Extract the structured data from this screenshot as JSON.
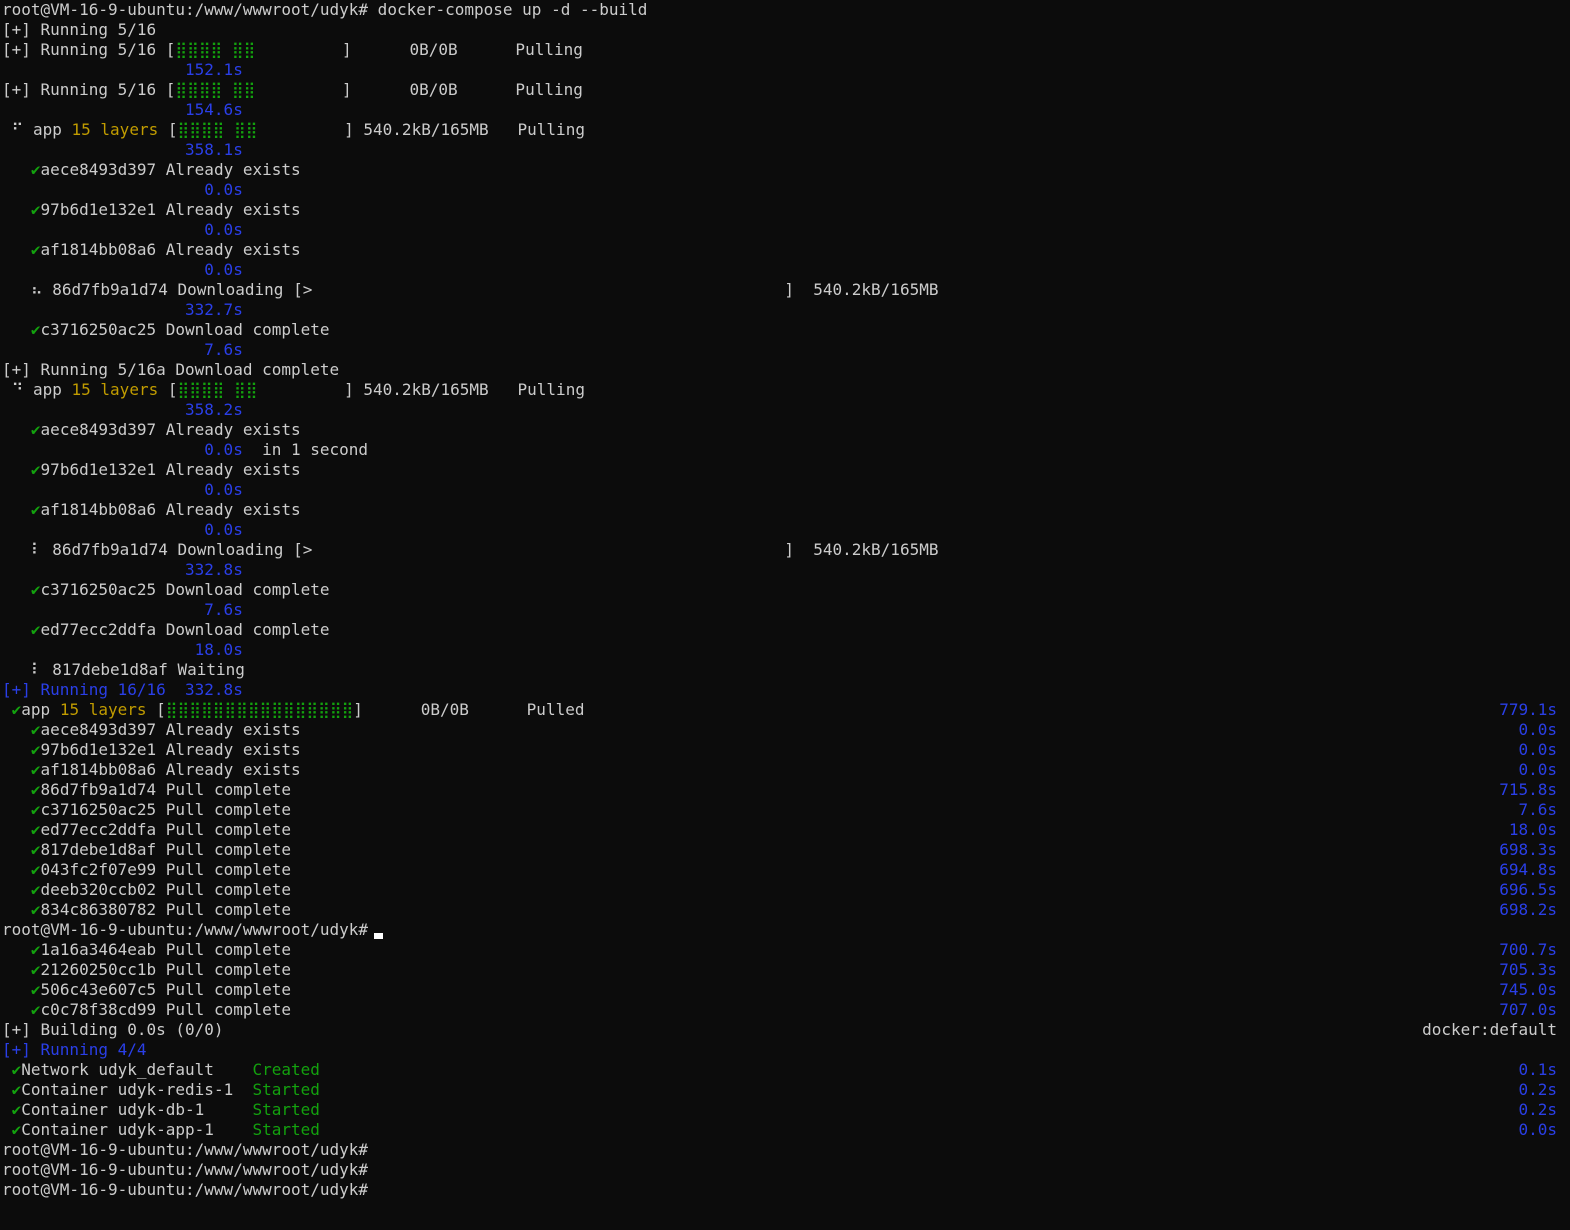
{
  "window": {
    "title": "root@VM-16-9-ubuntu: /www/wwwroot/udyk",
    "cursor_line": 46
  },
  "colors": {
    "background": "#0c0c0c",
    "text": "#cccccc",
    "blue": "#2a3fe8",
    "yellow": "#c19c00",
    "green": "#13a10e"
  },
  "terminal": {
    "lines": [
      {
        "segs": [
          {
            "t": "root@VM-16-9-ubuntu:/www/wwwroot/udyk# docker-compose up -d --build",
            "c": "default"
          }
        ]
      },
      {
        "segs": [
          {
            "t": "[+] Running 5/16",
            "c": "default"
          }
        ]
      },
      {
        "segs": [
          {
            "t": "[+] Running 5/16 [",
            "c": "default"
          },
          {
            "t": "⣿⣿⣿⣿ ⣿⣿",
            "c": "green"
          },
          {
            "t": "         ]      0B/0B      Pulling",
            "c": "default"
          }
        ]
      },
      {
        "segs": [
          {
            "t": "                   152.1s",
            "c": "blue"
          }
        ]
      },
      {
        "segs": [
          {
            "t": "[+] Running 5/16 [",
            "c": "default"
          },
          {
            "t": "⣿⣿⣿⣿ ⣿⣿",
            "c": "green"
          },
          {
            "t": "         ]      0B/0B      Pulling",
            "c": "default"
          }
        ]
      },
      {
        "segs": [
          {
            "t": "                   154.6s",
            "c": "blue"
          }
        ]
      },
      {
        "segs": [
          {
            "t": " ⠋ app ",
            "c": "default"
          },
          {
            "t": "15 layers",
            "c": "yellow"
          },
          {
            "t": " [",
            "c": "default"
          },
          {
            "t": "⣿⣿⣿⣿ ⣿⣿",
            "c": "green"
          },
          {
            "t": "         ] 540.2kB/165MB   Pulling",
            "c": "default"
          }
        ]
      },
      {
        "segs": [
          {
            "t": "                   358.1s",
            "c": "blue"
          }
        ]
      },
      {
        "segs": [
          {
            "t": "   ",
            "c": "default"
          },
          {
            "t": "✔",
            "c": "green"
          },
          {
            "t": "aece8493d397 Already exists",
            "c": "default"
          }
        ]
      },
      {
        "segs": [
          {
            "t": "                     0.0s",
            "c": "blue"
          }
        ]
      },
      {
        "segs": [
          {
            "t": "   ",
            "c": "default"
          },
          {
            "t": "✔",
            "c": "green"
          },
          {
            "t": "97b6d1e132e1 Already exists",
            "c": "default"
          }
        ]
      },
      {
        "segs": [
          {
            "t": "                     0.0s",
            "c": "blue"
          }
        ]
      },
      {
        "segs": [
          {
            "t": "   ",
            "c": "default"
          },
          {
            "t": "✔",
            "c": "green"
          },
          {
            "t": "af1814bb08a6 Already exists",
            "c": "default"
          }
        ]
      },
      {
        "segs": [
          {
            "t": "                     0.0s",
            "c": "blue"
          }
        ]
      },
      {
        "segs": [
          {
            "t": "   ⠦ 86d7fb9a1d74 Downloading [>                                                 ]  540.2kB/165MB",
            "c": "default"
          }
        ]
      },
      {
        "segs": [
          {
            "t": "                   332.7s",
            "c": "blue"
          }
        ]
      },
      {
        "segs": [
          {
            "t": "   ",
            "c": "default"
          },
          {
            "t": "✔",
            "c": "green"
          },
          {
            "t": "c3716250ac25 Download complete",
            "c": "default"
          }
        ]
      },
      {
        "segs": [
          {
            "t": "                     7.6s",
            "c": "blue"
          }
        ]
      },
      {
        "segs": [
          {
            "t": "[+] Running 5/16a Download complete",
            "c": "default"
          }
        ]
      },
      {
        "segs": [
          {
            "t": " ⠙ app ",
            "c": "default"
          },
          {
            "t": "15 layers",
            "c": "yellow"
          },
          {
            "t": " [",
            "c": "default"
          },
          {
            "t": "⣿⣿⣿⣿ ⣿⣿",
            "c": "green"
          },
          {
            "t": "         ] 540.2kB/165MB   Pulling",
            "c": "default"
          }
        ]
      },
      {
        "segs": [
          {
            "t": "                   358.2s",
            "c": "blue"
          }
        ]
      },
      {
        "segs": [
          {
            "t": "   ",
            "c": "default"
          },
          {
            "t": "✔",
            "c": "green"
          },
          {
            "t": "aece8493d397 Already exists",
            "c": "default"
          }
        ]
      },
      {
        "segs": [
          {
            "t": "                     0.0s",
            "c": "blue"
          },
          {
            "t": "  in 1 second",
            "c": "default"
          }
        ]
      },
      {
        "segs": [
          {
            "t": "   ",
            "c": "default"
          },
          {
            "t": "✔",
            "c": "green"
          },
          {
            "t": "97b6d1e132e1 Already exists",
            "c": "default"
          }
        ]
      },
      {
        "segs": [
          {
            "t": "                     0.0s",
            "c": "blue"
          }
        ]
      },
      {
        "segs": [
          {
            "t": "   ",
            "c": "default"
          },
          {
            "t": "✔",
            "c": "green"
          },
          {
            "t": "af1814bb08a6 Already exists",
            "c": "default"
          }
        ]
      },
      {
        "segs": [
          {
            "t": "                     0.0s",
            "c": "blue"
          }
        ]
      },
      {
        "segs": [
          {
            "t": "   ⠇ 86d7fb9a1d74 Downloading [>                                                 ]  540.2kB/165MB",
            "c": "default"
          }
        ]
      },
      {
        "segs": [
          {
            "t": "                   332.8s",
            "c": "blue"
          }
        ]
      },
      {
        "segs": [
          {
            "t": "   ",
            "c": "default"
          },
          {
            "t": "✔",
            "c": "green"
          },
          {
            "t": "c3716250ac25 Download complete",
            "c": "default"
          }
        ]
      },
      {
        "segs": [
          {
            "t": "                     7.6s",
            "c": "blue"
          }
        ]
      },
      {
        "segs": [
          {
            "t": "   ",
            "c": "default"
          },
          {
            "t": "✔",
            "c": "green"
          },
          {
            "t": "ed77ecc2ddfa Download complete",
            "c": "default"
          }
        ]
      },
      {
        "segs": [
          {
            "t": "                    18.0s",
            "c": "blue"
          }
        ]
      },
      {
        "segs": [
          {
            "t": "   ⠇ 817debe1d8af Waiting",
            "c": "default"
          }
        ]
      },
      {
        "segs": [
          {
            "t": "[+] Running 16/16  332.8s",
            "c": "blue"
          }
        ]
      },
      {
        "segs": [
          {
            "t": " ",
            "c": "default"
          },
          {
            "t": "✔",
            "c": "green"
          },
          {
            "t": "app ",
            "c": "default"
          },
          {
            "t": "15 layers",
            "c": "yellow"
          },
          {
            "t": " [",
            "c": "default"
          },
          {
            "t": "⣿⣿⣿⣿⣿⣿⣿⣿⣿⣿⣿⣿⣿⣿⣿⣿",
            "c": "green"
          },
          {
            "t": "]      0B/0B      Pulled",
            "c": "default"
          }
        ],
        "right": {
          "t": "779.1s",
          "c": "blue"
        }
      },
      {
        "segs": [
          {
            "t": "   ",
            "c": "default"
          },
          {
            "t": "✔",
            "c": "green"
          },
          {
            "t": "aece8493d397 Already exists",
            "c": "default"
          }
        ],
        "right": {
          "t": "0.0s",
          "c": "blue"
        }
      },
      {
        "segs": [
          {
            "t": "   ",
            "c": "default"
          },
          {
            "t": "✔",
            "c": "green"
          },
          {
            "t": "97b6d1e132e1 Already exists",
            "c": "default"
          }
        ],
        "right": {
          "t": "0.0s",
          "c": "blue"
        }
      },
      {
        "segs": [
          {
            "t": "   ",
            "c": "default"
          },
          {
            "t": "✔",
            "c": "green"
          },
          {
            "t": "af1814bb08a6 Already exists",
            "c": "default"
          }
        ],
        "right": {
          "t": "0.0s",
          "c": "blue"
        }
      },
      {
        "segs": [
          {
            "t": "   ",
            "c": "default"
          },
          {
            "t": "✔",
            "c": "green"
          },
          {
            "t": "86d7fb9a1d74 Pull complete",
            "c": "default"
          }
        ],
        "right": {
          "t": "715.8s",
          "c": "blue"
        }
      },
      {
        "segs": [
          {
            "t": "   ",
            "c": "default"
          },
          {
            "t": "✔",
            "c": "green"
          },
          {
            "t": "c3716250ac25 Pull complete",
            "c": "default"
          }
        ],
        "right": {
          "t": "7.6s",
          "c": "blue"
        }
      },
      {
        "segs": [
          {
            "t": "   ",
            "c": "default"
          },
          {
            "t": "✔",
            "c": "green"
          },
          {
            "t": "ed77ecc2ddfa Pull complete",
            "c": "default"
          }
        ],
        "right": {
          "t": "18.0s",
          "c": "blue"
        }
      },
      {
        "segs": [
          {
            "t": "   ",
            "c": "default"
          },
          {
            "t": "✔",
            "c": "green"
          },
          {
            "t": "817debe1d8af Pull complete",
            "c": "default"
          }
        ],
        "right": {
          "t": "698.3s",
          "c": "blue"
        }
      },
      {
        "segs": [
          {
            "t": "   ",
            "c": "default"
          },
          {
            "t": "✔",
            "c": "green"
          },
          {
            "t": "043fc2f07e99 Pull complete",
            "c": "default"
          }
        ],
        "right": {
          "t": "694.8s",
          "c": "blue"
        }
      },
      {
        "segs": [
          {
            "t": "   ",
            "c": "default"
          },
          {
            "t": "✔",
            "c": "green"
          },
          {
            "t": "deeb320ccb02 Pull complete",
            "c": "default"
          }
        ],
        "right": {
          "t": "696.5s",
          "c": "blue"
        }
      },
      {
        "segs": [
          {
            "t": "   ",
            "c": "default"
          },
          {
            "t": "✔",
            "c": "green"
          },
          {
            "t": "834c86380782 Pull complete",
            "c": "default"
          }
        ],
        "right": {
          "t": "698.2s",
          "c": "blue"
        }
      },
      {
        "segs": [
          {
            "t": "root@VM-16-9-ubuntu:/www/wwwroot/udyk#",
            "c": "default"
          }
        ]
      },
      {
        "segs": [
          {
            "t": "   ",
            "c": "default"
          },
          {
            "t": "✔",
            "c": "green"
          },
          {
            "t": "1a16a3464eab Pull complete",
            "c": "default"
          }
        ],
        "right": {
          "t": "700.7s",
          "c": "blue"
        }
      },
      {
        "segs": [
          {
            "t": "   ",
            "c": "default"
          },
          {
            "t": "✔",
            "c": "green"
          },
          {
            "t": "21260250cc1b Pull complete",
            "c": "default"
          }
        ],
        "right": {
          "t": "705.3s",
          "c": "blue"
        }
      },
      {
        "segs": [
          {
            "t": "   ",
            "c": "default"
          },
          {
            "t": "✔",
            "c": "green"
          },
          {
            "t": "506c43e607c5 Pull complete",
            "c": "default"
          }
        ],
        "right": {
          "t": "745.0s",
          "c": "blue"
        }
      },
      {
        "segs": [
          {
            "t": "   ",
            "c": "default"
          },
          {
            "t": "✔",
            "c": "green"
          },
          {
            "t": "c0c78f38cd99 Pull complete",
            "c": "default"
          }
        ],
        "right": {
          "t": "707.0s",
          "c": "blue"
        }
      },
      {
        "segs": [
          {
            "t": "[+] Building 0.0s (0/0)",
            "c": "default"
          }
        ],
        "right": {
          "t": "docker:default",
          "c": "default"
        }
      },
      {
        "segs": [
          {
            "t": "[+] Running 4/4",
            "c": "blue"
          }
        ]
      },
      {
        "segs": [
          {
            "t": " ",
            "c": "default"
          },
          {
            "t": "✔",
            "c": "green"
          },
          {
            "t": "Network udyk_default    ",
            "c": "default"
          },
          {
            "t": "Created",
            "c": "green"
          }
        ],
        "right": {
          "t": "0.1s",
          "c": "blue"
        }
      },
      {
        "segs": [
          {
            "t": " ",
            "c": "default"
          },
          {
            "t": "✔",
            "c": "green"
          },
          {
            "t": "Container udyk-redis-1  ",
            "c": "default"
          },
          {
            "t": "Started",
            "c": "green"
          }
        ],
        "right": {
          "t": "0.2s",
          "c": "blue"
        }
      },
      {
        "segs": [
          {
            "t": " ",
            "c": "default"
          },
          {
            "t": "✔",
            "c": "green"
          },
          {
            "t": "Container udyk-db-1     ",
            "c": "default"
          },
          {
            "t": "Started",
            "c": "green"
          }
        ],
        "right": {
          "t": "0.2s",
          "c": "blue"
        }
      },
      {
        "segs": [
          {
            "t": " ",
            "c": "default"
          },
          {
            "t": "✔",
            "c": "green"
          },
          {
            "t": "Container udyk-app-1    ",
            "c": "default"
          },
          {
            "t": "Started",
            "c": "green"
          }
        ],
        "right": {
          "t": "0.0s",
          "c": "blue"
        }
      },
      {
        "segs": [
          {
            "t": "root@VM-16-9-ubuntu:/www/wwwroot/udyk#",
            "c": "default"
          }
        ]
      },
      {
        "segs": [
          {
            "t": "root@VM-16-9-ubuntu:/www/wwwroot/udyk#",
            "c": "default"
          }
        ]
      },
      {
        "segs": [
          {
            "t": "root@VM-16-9-ubuntu:/www/wwwroot/udyk#",
            "c": "default"
          }
        ]
      }
    ]
  }
}
